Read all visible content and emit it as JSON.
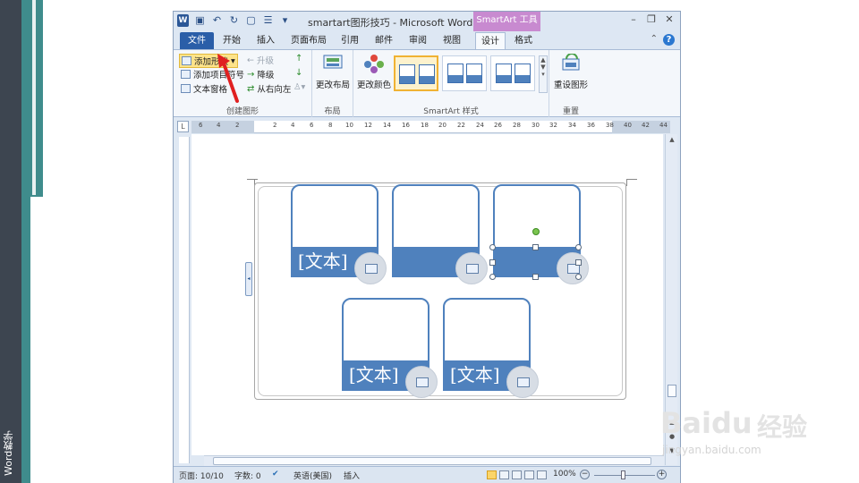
{
  "side_label": "Word教学",
  "window": {
    "title": "smartart图形技巧 - Microsoft Word",
    "context_tab_header": "SmartArt 工具"
  },
  "tabs": [
    {
      "label": "文件"
    },
    {
      "label": "开始"
    },
    {
      "label": "插入"
    },
    {
      "label": "页面布局"
    },
    {
      "label": "引用"
    },
    {
      "label": "邮件"
    },
    {
      "label": "审阅"
    },
    {
      "label": "视图"
    },
    {
      "label": "设计"
    },
    {
      "label": "格式"
    }
  ],
  "ribbon": {
    "create_group": {
      "label": "创建图形",
      "add_shape": "添加形状",
      "add_bullet": "添加项目符号",
      "text_pane": "文本窗格",
      "promote": "升级",
      "demote": "降级",
      "right_to_left": "从右向左"
    },
    "layout_group": {
      "label": "布局",
      "change_layout": "更改布局"
    },
    "styles_group": {
      "label": "SmartArt 样式",
      "change_colors": "更改颜色"
    },
    "reset_group": {
      "label": "重置",
      "reset_graphic": "重设图形"
    }
  },
  "ruler": {
    "numbers": [
      "6",
      "4",
      "2",
      "",
      "2",
      "4",
      "6",
      "8",
      "10",
      "12",
      "14",
      "16",
      "18",
      "20",
      "22",
      "24",
      "26",
      "28",
      "30",
      "32",
      "34",
      "36",
      "38",
      "40",
      "42",
      "44"
    ]
  },
  "smartart": {
    "cards": [
      {
        "text": "[文本]"
      },
      {
        "text": ""
      },
      {
        "text": ""
      },
      {
        "text": "[文本]"
      },
      {
        "text": "[文本]"
      }
    ]
  },
  "status": {
    "page": "页面: 10/10",
    "words": "字数: 0",
    "language": "英语(美国)",
    "mode": "插入",
    "zoom": "100%"
  },
  "watermark": {
    "brand": "Baidu",
    "jingyan": "经验",
    "url": "jingyan.baidu.com"
  },
  "colors": {
    "accent": "#4f81bd",
    "file_tab": "#2a5ea8",
    "context_tab": "#c88ad0"
  }
}
